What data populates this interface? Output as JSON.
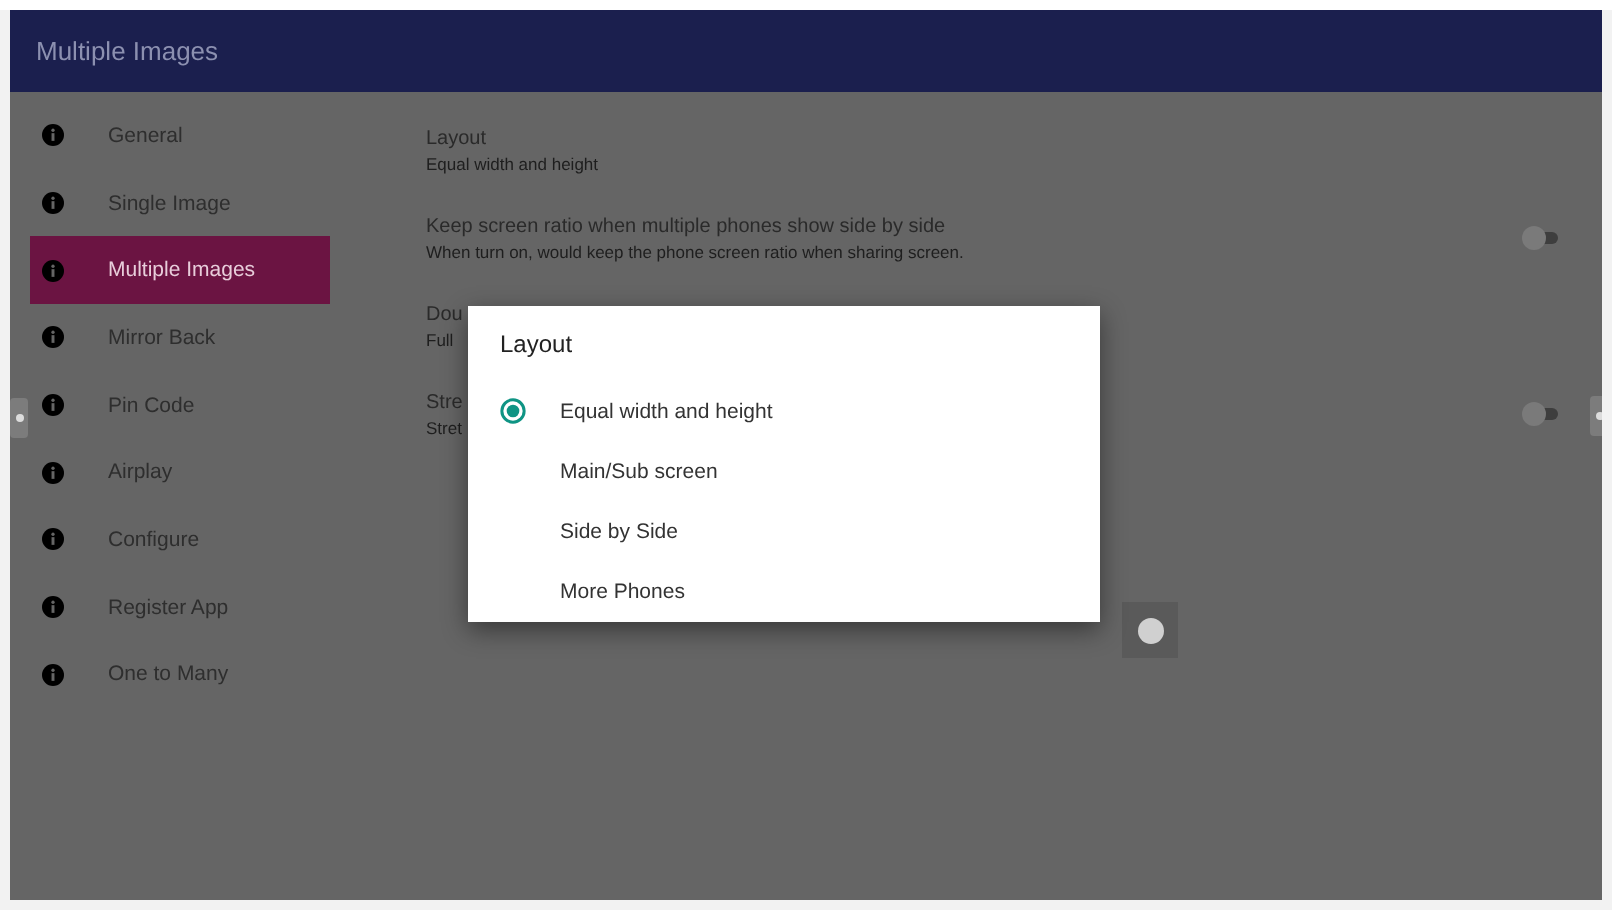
{
  "header": {
    "title": "Multiple Images"
  },
  "sidebar": {
    "items": [
      {
        "label": "General",
        "selected": false
      },
      {
        "label": "Single Image",
        "selected": false
      },
      {
        "label": "Multiple Images",
        "selected": true
      },
      {
        "label": "Mirror Back",
        "selected": false
      },
      {
        "label": "Pin Code",
        "selected": false
      },
      {
        "label": "Airplay",
        "selected": false
      },
      {
        "label": "Configure",
        "selected": false
      },
      {
        "label": "Register App",
        "selected": false
      },
      {
        "label": "One to Many",
        "selected": false
      }
    ]
  },
  "settings": [
    {
      "kind": "value",
      "title": "Layout",
      "subtitle": "Equal width and height"
    },
    {
      "kind": "toggle",
      "title": "Keep screen ratio when multiple phones show side by side",
      "subtitle": "When turn on, would keep the phone screen ratio when sharing screen.",
      "on": false
    },
    {
      "kind": "value",
      "title": "Dou",
      "subtitle": "Full"
    },
    {
      "kind": "toggle",
      "title": "Stre",
      "subtitle": "Stret",
      "on": false
    }
  ],
  "dialog": {
    "title": "Layout",
    "options": [
      {
        "label": "Equal width and height",
        "selected": true
      },
      {
        "label": "Main/Sub screen",
        "selected": false
      },
      {
        "label": "Side by Side",
        "selected": false
      },
      {
        "label": "More Phones",
        "selected": false
      }
    ]
  }
}
